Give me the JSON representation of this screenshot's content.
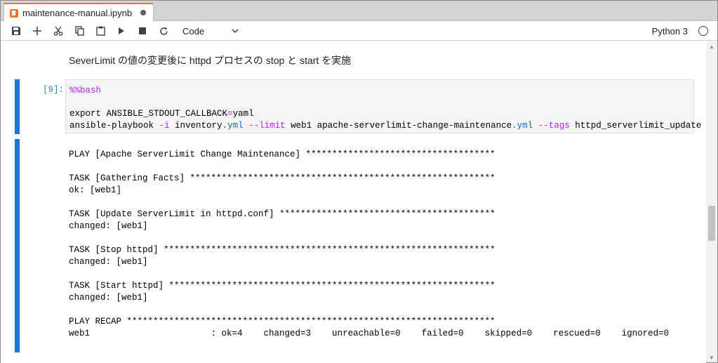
{
  "tab": {
    "title": "maintenance-manual.ipynb"
  },
  "toolbar": {
    "cell_type": "Code",
    "kernel": "Python 3",
    "icons": [
      "save-icon",
      "add-icon",
      "cut-icon",
      "copy-icon",
      "paste-icon",
      "run-icon",
      "stop-icon",
      "restart-icon"
    ]
  },
  "markdown_text": "SeverLimit の値の変更後に httpd プロセスの stop と start を実施",
  "code_cell": {
    "prompt": "[9]:",
    "magic": "%%bash",
    "line2_prefix": "export ANSIBLE_STDOUT_CALLBACK",
    "line2_eq": "=",
    "line2_suffix": "yaml",
    "line3_a": "ansible-playbook ",
    "line3_b": "-i",
    "line3_c": " inventory",
    "line3_d": ".yml",
    "line3_e": " ",
    "line3_f": "--limit",
    "line3_g": " web1 apache-serverlimit-change-maintenance",
    "line3_h": ".yml",
    "line3_i": " ",
    "line3_j": "--tags",
    "line3_k": " httpd_serverlimit_update"
  },
  "output": [
    "PLAY [Apache ServerLimit Change Maintenance] ************************************",
    "",
    "TASK [Gathering Facts] **********************************************************",
    "ok: [web1]",
    "",
    "TASK [Update ServerLimit in httpd.conf] *****************************************",
    "changed: [web1]",
    "",
    "TASK [Stop httpd] ***************************************************************",
    "changed: [web1]",
    "",
    "TASK [Start httpd] **************************************************************",
    "changed: [web1]",
    "",
    "PLAY RECAP **********************************************************************",
    "web1                       : ok=4    changed=3    unreachable=0    failed=0    skipped=0    rescued=0    ignored=0"
  ],
  "colors": {
    "accent": "#f37626",
    "cell_bar": "#1976d2",
    "prompt": "#307fc1",
    "magic": "#aa22ff",
    "ext": "#1565c0"
  }
}
